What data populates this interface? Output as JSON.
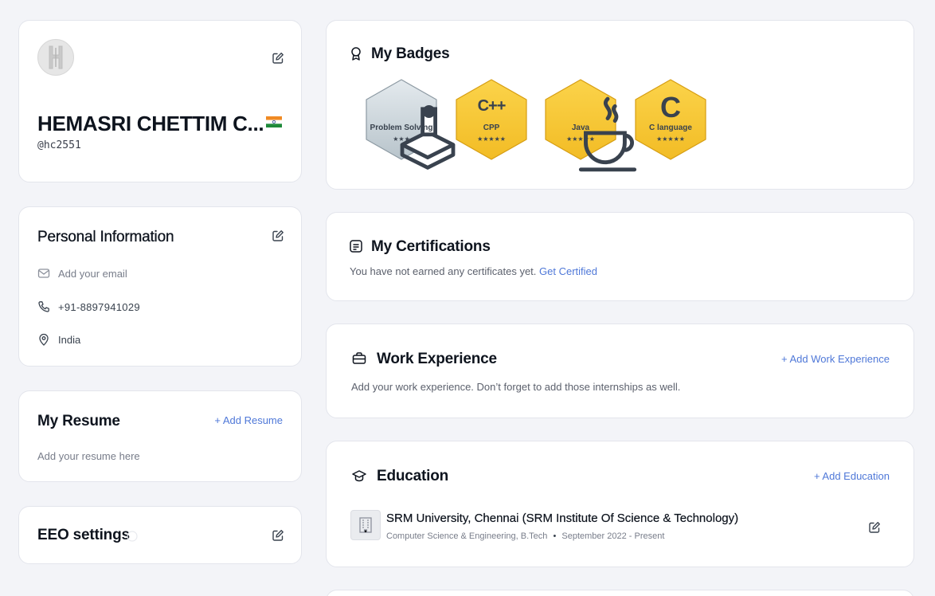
{
  "profile": {
    "avatar_letter": "H",
    "name": "HEMASRI CHETTIM C...",
    "handle": "@hc2551"
  },
  "personal_info": {
    "title": "Personal Information",
    "email_placeholder": "Add your email",
    "phone": "+91-8897941029",
    "location": "India"
  },
  "resume": {
    "title": "My Resume",
    "add_label": "+ Add Resume",
    "placeholder": "Add your resume here"
  },
  "eeo": {
    "title": "EEO settings"
  },
  "badges": {
    "title": "My Badges",
    "items": [
      {
        "label": "Problem Solving",
        "stars": "★★★",
        "icon_name": "problem-solving-icon",
        "tier": "silver"
      },
      {
        "label": "CPP",
        "stars": "★★★★★",
        "icon_name": "cpp-icon",
        "glyph": "C++",
        "tier": "gold"
      },
      {
        "label": "Java",
        "stars": "★★★★★",
        "icon_name": "java-cup-icon",
        "tier": "gold"
      },
      {
        "label": "C language",
        "stars": "★★★★★",
        "icon_name": "c-letter-icon",
        "glyph": "C",
        "tier": "gold"
      }
    ]
  },
  "certifications": {
    "title": "My Certifications",
    "message": "You have not earned any certificates yet.",
    "link": "Get Certified"
  },
  "work": {
    "title": "Work Experience",
    "add_label": "+ Add Work Experience",
    "message": "Add your work experience. Don’t forget to add those internships as well."
  },
  "education": {
    "title": "Education",
    "add_label": "+ Add Education",
    "entries": [
      {
        "school": "SRM University, Chennai (SRM Institute Of Science & Technology)",
        "degree": "Computer Science & Engineering, B.Tech",
        "separator": "•",
        "dates": "September 2022 - Present"
      }
    ]
  },
  "colors": {
    "accent": "#4f78d8",
    "gold": "#f5c330",
    "silver": "#c9d3d9"
  }
}
